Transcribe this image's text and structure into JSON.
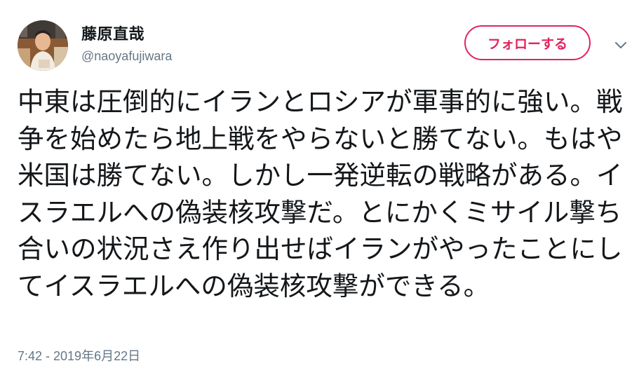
{
  "user": {
    "display_name": "藤原直哉",
    "handle": "@naoyafujiwara",
    "avatar_icon": "profile-photo"
  },
  "follow_button": {
    "label": "フォローする",
    "color": "#e0245e"
  },
  "menu": {
    "caret_icon": "chevron-down-icon"
  },
  "tweet": {
    "text": "中東は圧倒的にイランとロシアが軍事的に強い。戦争を始めたら地上戦をやらないと勝てない。もはや米国は勝てない。しかし一発逆転の戦略がある。イスラエルへの偽装核攻撃だ。とにかくミサイル撃ち合いの状況さえ作り出せばイランがやったことにしてイスラエルへの偽装核攻撃ができる。",
    "timestamp": "7:42 - 2019年6月22日"
  },
  "colors": {
    "text": "#14171a",
    "secondary": "#657786",
    "accent": "#e0245e"
  }
}
